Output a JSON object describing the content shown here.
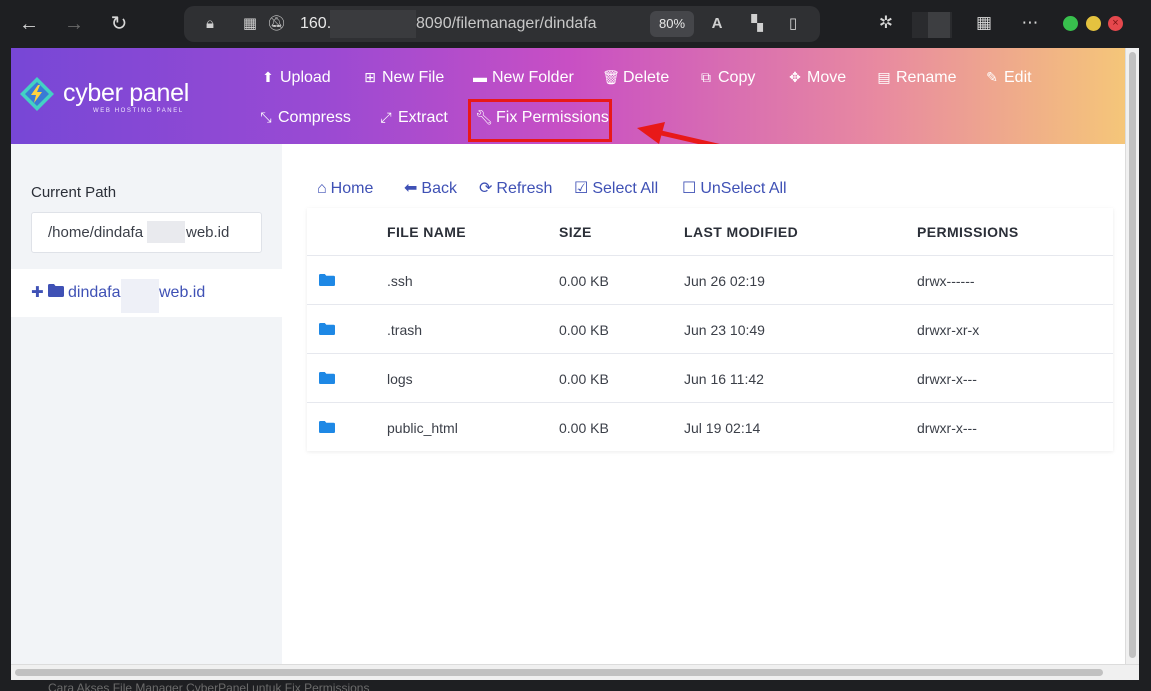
{
  "browser": {
    "url_host": "160.",
    "url_path": "8090/filemanager/dindafa",
    "zoom": "80%",
    "window_close": "×"
  },
  "header": {
    "logo_name": "cyber panel",
    "logo_sub": "WEB HOSTING PANEL",
    "toolbar": {
      "upload": "Upload",
      "new_file": "New File",
      "new_folder": "New Folder",
      "delete": "Delete",
      "copy": "Copy",
      "move": "Move",
      "rename": "Rename",
      "edit": "Edit",
      "compress": "Compress",
      "extract": "Extract",
      "fix_permissions": "Fix Permissions"
    }
  },
  "sidebar": {
    "current_path_label": "Current Path",
    "path_prefix": "/home/dindafa",
    "path_suffix": "web.id",
    "tree_name": "dindafa",
    "tree_suffix": "web.id"
  },
  "main": {
    "nav": {
      "home": "Home",
      "back": "Back",
      "refresh": "Refresh",
      "select_all": "Select All",
      "unselect_all": "UnSelect All"
    },
    "columns": [
      "FILE NAME",
      "SIZE",
      "LAST MODIFIED",
      "PERMISSIONS"
    ],
    "rows": [
      {
        "name": ".ssh",
        "size": "0.00 KB",
        "modified": "Jun 26 02:19",
        "permissions": "drwx------"
      },
      {
        "name": ".trash",
        "size": "0.00 KB",
        "modified": "Jun 23 10:49",
        "permissions": "drwxr-xr-x"
      },
      {
        "name": "logs",
        "size": "0.00 KB",
        "modified": "Jun 16 11:42",
        "permissions": "drwxr-x---"
      },
      {
        "name": "public_html",
        "size": "0.00 KB",
        "modified": "Jul 19 02:14",
        "permissions": "drwxr-x---"
      }
    ]
  },
  "below_page_text": "Cara Akses File Manager CyberPanel untuk Fix Permissions",
  "colors": {
    "accent": "#3f51b5",
    "folder": "#1e88e5",
    "highlight": "#e81919",
    "header_start": "#7747d6",
    "header_end": "#f5c679"
  },
  "icons": {
    "upload": "upload-icon",
    "new_file": "plus-square-icon",
    "new_folder": "folder-icon",
    "delete": "trash-icon",
    "copy": "copy-icon",
    "move": "move-icon",
    "rename": "file-icon",
    "edit": "edit-icon",
    "compress": "compress-icon",
    "extract": "expand-icon",
    "fix_permissions": "wrench-icon",
    "home": "home-icon",
    "back": "arrow-left-icon",
    "refresh": "refresh-icon",
    "select_all": "checkbox-checked-icon",
    "unselect_all": "checkbox-empty-icon"
  }
}
